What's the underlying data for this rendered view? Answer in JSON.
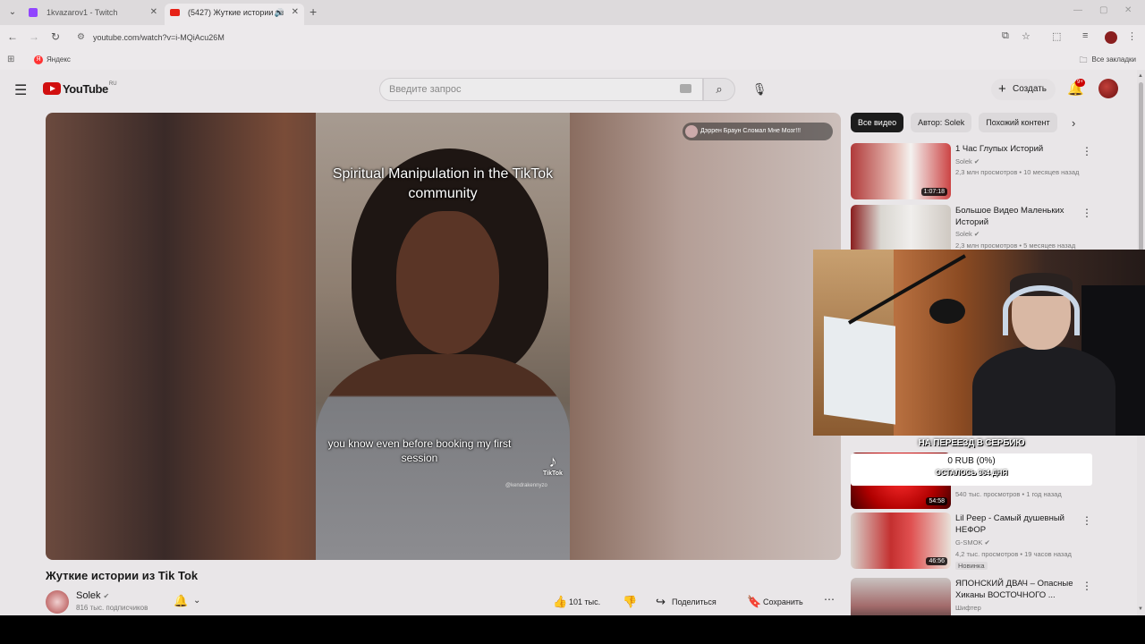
{
  "browser": {
    "tabs": [
      {
        "title": "1kvazarov1 - Twitch",
        "active": false
      },
      {
        "title": "(5427) Жуткие истории из",
        "active": true
      }
    ],
    "url": "youtube.com/watch?v=i-MQiAcu26M",
    "bookmarks": {
      "yandex": "Яндекс",
      "all": "Все закладки"
    }
  },
  "header": {
    "logo_text": "YouTube",
    "logo_region": "RU",
    "search_placeholder": "Введите запрос",
    "create_label": "Создать",
    "notifications_badge": "9+"
  },
  "video": {
    "caption_top": "Spiritual Manipulation in the TikTok community",
    "caption_bottom": "you know even before booking my first session",
    "tiktok_label": "TikTok",
    "tiktok_user": "@kendrakennyzo",
    "overlay_chip": "Дэррен Браун Сломал Мне Мозг!!!",
    "title": "Жуткие истории из Tik Tok",
    "channel": "Solek",
    "subscribers": "816 тыс. подписчиков",
    "likes": "101 тыс.",
    "share_label": "Поделиться",
    "save_label": "Сохранить"
  },
  "chips": [
    "Все видео",
    "Автор: Solek",
    "Похожий контент"
  ],
  "recommendations": [
    {
      "title": "1 Час Глупых Историй",
      "channel": "Solek",
      "meta": "2,3 млн просмотров • 10 месяцев назад",
      "duration": "1:07:18"
    },
    {
      "title": "Большое Видео Маленьких Историй",
      "channel": "Solek",
      "meta": "2,3 млн просмотров • 5 месяцев назад",
      "duration": ""
    },
    {
      "title": "",
      "channel": "",
      "meta": "540 тыс. просмотров • 1 год назад",
      "duration": "54:58"
    },
    {
      "title": "Lil Peep - Самый душевный НЕФОР",
      "channel": "G-SMOK",
      "meta": "4,2 тыс. просмотров • 19 часов назад",
      "duration": "46:56",
      "badge": "Новинка"
    },
    {
      "title": "ЯПОНСКИЙ ДВАЧ – Опасные Хиканы ВОСТОЧНОГО ...",
      "channel": "Шифтер",
      "meta": "",
      "duration": ""
    }
  ],
  "stream_goal": {
    "title": "НА ПЕРЕЕЗД В СЕРБИЮ",
    "amount": "0 RUB (0%)",
    "remaining": "ОСТАЛОСЬ 364 ДНЯ"
  }
}
